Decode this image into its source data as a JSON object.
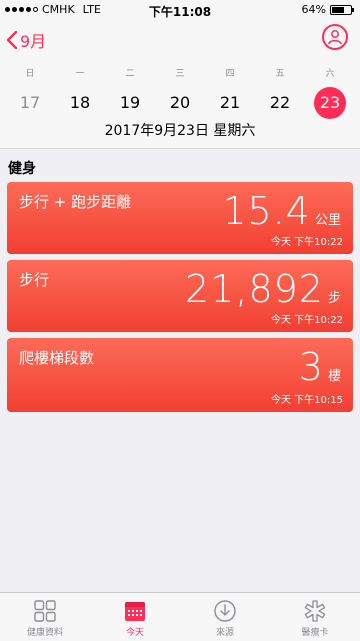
{
  "status": {
    "carrier": "CMHK",
    "network": "LTE",
    "time": "下午11:08",
    "battery": "64%",
    "battery_level": 0.64
  },
  "header": {
    "back_label": "9月",
    "week_labels": [
      "日",
      "一",
      "二",
      "三",
      "四",
      "五",
      "六"
    ],
    "week_dates": [
      "17",
      "18",
      "19",
      "20",
      "21",
      "22",
      "23"
    ],
    "full_date": "2017年9月23日 星期六"
  },
  "section": {
    "title": "健身"
  },
  "cards": [
    {
      "title": "步行 + 跑步距離",
      "value": "15.4",
      "unit": "公里",
      "time": "今天 下午10:22"
    },
    {
      "title": "步行",
      "value": "21,892",
      "unit": "步",
      "time": "今天 下午10:22"
    },
    {
      "title": "爬樓梯段數",
      "value": "3",
      "unit": "樓",
      "time": "今天 下午10:15"
    }
  ],
  "tabs": [
    {
      "label": "健康資料",
      "icon": "grid-icon"
    },
    {
      "label": "今天",
      "icon": "calendar-icon"
    },
    {
      "label": "來源",
      "icon": "download-icon"
    },
    {
      "label": "醫療卡",
      "icon": "medical-star-icon"
    }
  ],
  "colors": {
    "accent": "#ff2d55",
    "card_top": "#fd6b57",
    "card_bottom": "#f23f32"
  }
}
